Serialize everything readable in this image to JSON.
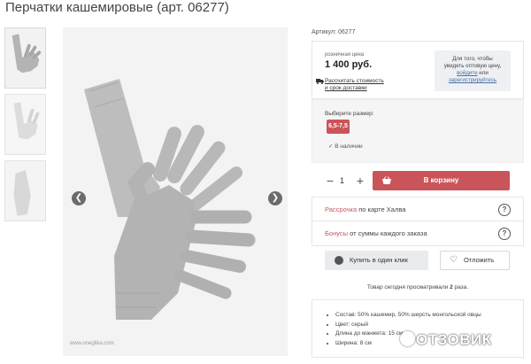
{
  "page": {
    "title": "Перчатки кашемировые (арт. 06277)"
  },
  "gallery": {
    "thumbnails": [
      "thumb-1",
      "thumb-2",
      "thumb-3"
    ],
    "prev_icon": "arrow-left-icon",
    "next_icon": "arrow-right-icon",
    "photo_watermark": "www.oneglika.com"
  },
  "product": {
    "sku": "Артикул: 06277",
    "price_label": "розничная цена",
    "price": "1 400 руб.",
    "calc_link_line1": "Рассчитать стоимость",
    "calc_link_line2": "и срок доставки",
    "wholesale_line1": "Для того, чтобы",
    "wholesale_line2": "увидеть оптовую цену,",
    "wholesale_link1": "войдите",
    "wholesale_or": " или",
    "wholesale_link2": "зарегистрируйтесь"
  },
  "size": {
    "label": "Выберите размер:",
    "selected": "6,5-7,5",
    "stock": "В наличии"
  },
  "cart": {
    "minus": "−",
    "quantity": "1",
    "plus": "+",
    "button_label": "В корзину"
  },
  "promos": [
    {
      "accent": "Рассрочка",
      "text": " по карте Халва"
    },
    {
      "accent": "Бонусы",
      "text": " от суммы каждого заказа"
    }
  ],
  "actions": {
    "oneclick_label": "Купить в один клик",
    "defer_label": "Отложить"
  },
  "viewed": {
    "prefix": "Товар сегодня просматривали ",
    "count": "2",
    "suffix": " раза."
  },
  "specs": [
    "Состав: 50% кашемир, 50% шерсть монгольской овцы",
    "Цвет: серый",
    "Длина до манжета: 15 см",
    "Ширина: 8 см"
  ],
  "watermark": {
    "text": "ОТЗОВИК"
  },
  "colors": {
    "accent": "#c9555b",
    "glove": "#b4b4b4"
  }
}
